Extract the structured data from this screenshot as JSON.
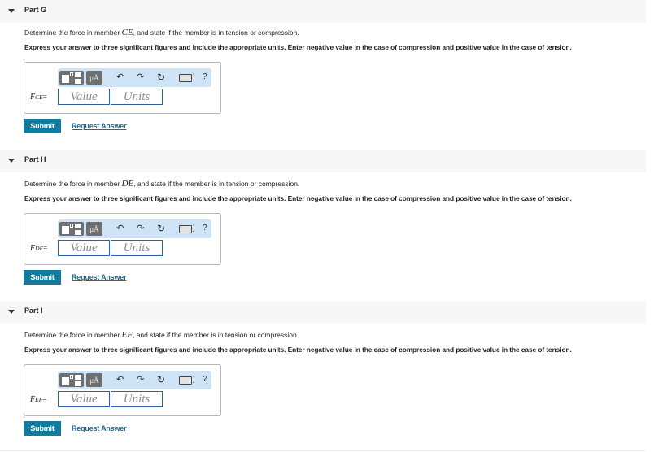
{
  "parts": [
    {
      "title": "Part G",
      "question_prefix": "Determine the force in member ",
      "member": "CE",
      "question_suffix": ", and state if the member is in tension or compression.",
      "instructions": "Express your answer to three significant figures and include the appropriate units. Enter negative value in the case of compression and positive value in the case of tension.",
      "var_main": "F",
      "var_sub": "CE",
      "var_eq": "=",
      "value_placeholder": "Value",
      "units_placeholder": "Units",
      "submit_label": "Submit",
      "request_label": "Request Answer"
    },
    {
      "title": "Part H",
      "question_prefix": "Determine the force in member ",
      "member": "DE",
      "question_suffix": ", and state if the member is in tension or compression.",
      "instructions": "Express your answer to three significant figures and include the appropriate units. Enter negative value in the case of compression and positive value in the case of tension.",
      "var_main": "F",
      "var_sub": "DE",
      "var_eq": "=",
      "value_placeholder": "Value",
      "units_placeholder": "Units",
      "submit_label": "Submit",
      "request_label": "Request Answer"
    },
    {
      "title": "Part I",
      "question_prefix": "Determine the force in member ",
      "member": "EF",
      "question_suffix": ", and state if the member is in tension or compression.",
      "instructions": "Express your answer to three significant figures and include the appropriate units. Enter negative value in the case of compression and positive value in the case of tension.",
      "var_main": "F",
      "var_sub": "EF",
      "var_eq": "=",
      "value_placeholder": "Value",
      "units_placeholder": "Units",
      "submit_label": "Submit",
      "request_label": "Request Answer"
    }
  ],
  "toolbar": {
    "units_glyph": "μÅ",
    "undo_glyph": "↶",
    "redo_glyph": "↷",
    "reset_glyph": "↻",
    "keyboard_bracket": "]",
    "help_glyph": "?"
  },
  "colors": {
    "submit_bg": "#117b9e",
    "link": "#1b6d96",
    "toolbar_bg": "#cfe3f7",
    "field_border": "#2f5fa8",
    "header_bg": "#f7f7f7"
  }
}
